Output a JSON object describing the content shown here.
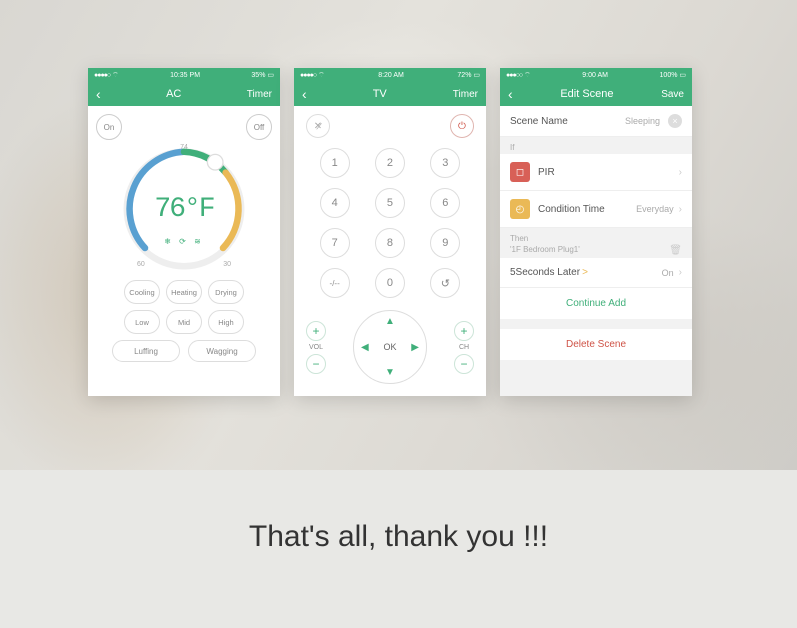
{
  "ac": {
    "status": {
      "sig": "●●●●○",
      "wifi": "⌔",
      "time": "10:35 PM",
      "batt": "35%"
    },
    "nav": {
      "title": "AC",
      "right": "Timer"
    },
    "on": "On",
    "off": "Off",
    "temp": "76°F",
    "t_top": "74",
    "t_bl": "60",
    "t_br": "30",
    "modes": [
      "Cooling",
      "Heating",
      "Drying"
    ],
    "fan": [
      "Low",
      "Mid",
      "High"
    ],
    "pills": [
      "Luffing",
      "Wagging"
    ]
  },
  "tv": {
    "status": {
      "sig": "●●●●○",
      "wifi": "⌔",
      "time": "8:20 AM",
      "batt": "72%"
    },
    "nav": {
      "title": "TV",
      "right": "Timer"
    },
    "keys": [
      "1",
      "2",
      "3",
      "4",
      "5",
      "6",
      "7",
      "8",
      "9",
      "-/--",
      "0",
      "↺"
    ],
    "vol": "VOL",
    "ch": "CH",
    "ok": "OK"
  },
  "scene": {
    "status": {
      "sig": "●●●○○",
      "wifi": "⌔",
      "time": "9:00 AM",
      "batt": "100%"
    },
    "nav": {
      "title": "Edit Scene",
      "right": "Save"
    },
    "name_lbl": "Scene Name",
    "name_val": "Sleeping",
    "if_lbl": "If",
    "pir": "PIR",
    "cond": "Condition Time",
    "cond_val": "Everyday",
    "then_lbl": "Then",
    "then_dev": "'1F Bedroom Plug1'",
    "delay": "5Seconds Later",
    "delay_chev": ">",
    "on": "On",
    "cont": "Continue Add",
    "del": "Delete Scene"
  },
  "footer": "That's all, thank you !!!"
}
